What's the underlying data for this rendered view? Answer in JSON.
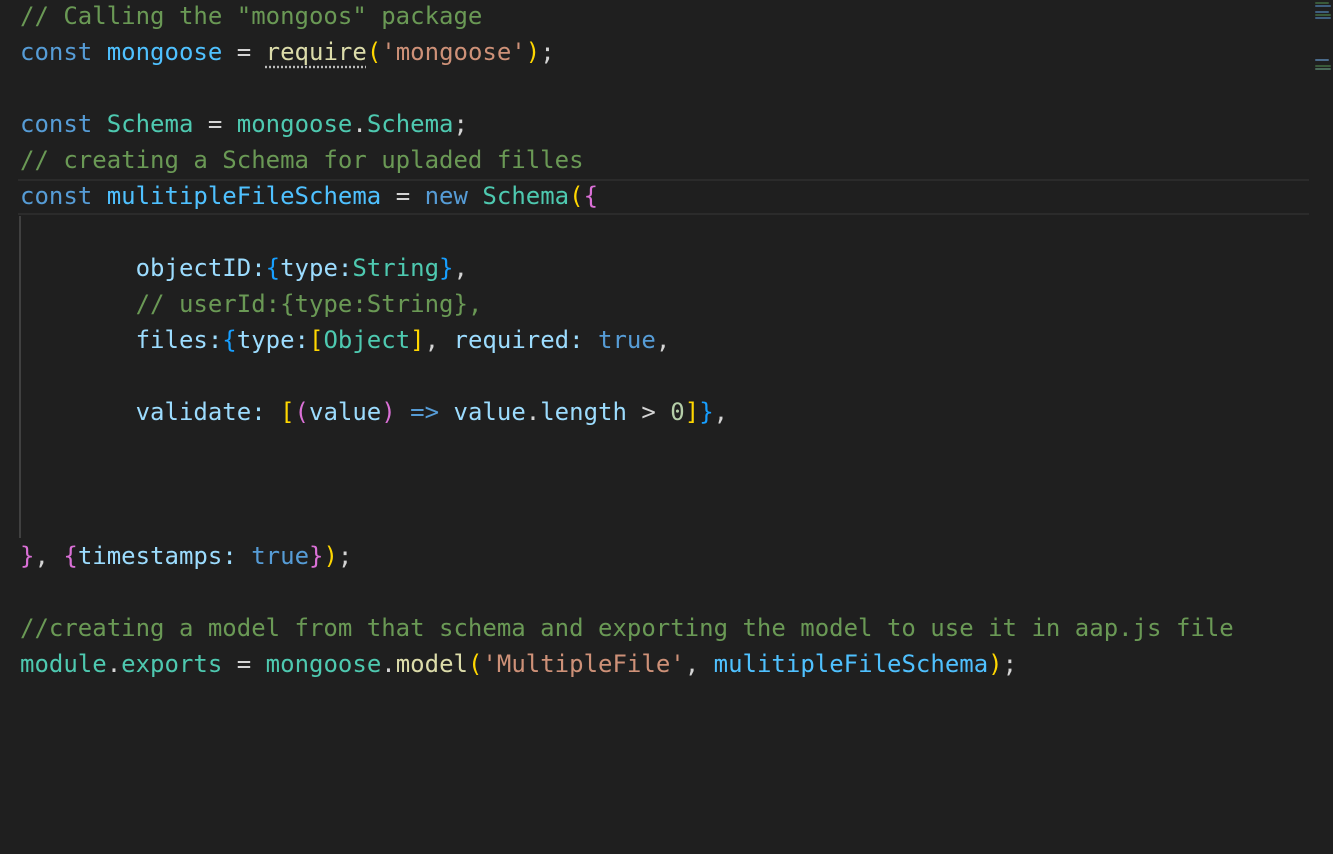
{
  "editor": {
    "language": "javascript",
    "lines": [
      {
        "tokens": [
          {
            "t": "// Calling the \"mongoos\" package",
            "c": "comment"
          }
        ]
      },
      {
        "tokens": [
          {
            "t": "const",
            "c": "kw"
          },
          {
            "t": " ",
            "c": "op"
          },
          {
            "t": "mongoose",
            "c": "const"
          },
          {
            "t": " = ",
            "c": "op"
          },
          {
            "t": "require",
            "c": "fn",
            "squiggle": true
          },
          {
            "t": "(",
            "c": "b1"
          },
          {
            "t": "'mongoose'",
            "c": "str"
          },
          {
            "t": ")",
            "c": "b1"
          },
          {
            "t": ";",
            "c": "op"
          }
        ]
      },
      {
        "tokens": []
      },
      {
        "tokens": [
          {
            "t": "const",
            "c": "kw"
          },
          {
            "t": " ",
            "c": "op"
          },
          {
            "t": "Schema",
            "c": "type"
          },
          {
            "t": " = ",
            "c": "op"
          },
          {
            "t": "mongoose",
            "c": "type"
          },
          {
            "t": ".",
            "c": "op"
          },
          {
            "t": "Schema",
            "c": "type"
          },
          {
            "t": ";",
            "c": "op"
          }
        ]
      },
      {
        "tokens": [
          {
            "t": "// creating a Schema for upladed filles",
            "c": "comment"
          }
        ]
      },
      {
        "current": true,
        "tokens": [
          {
            "t": "const",
            "c": "kw"
          },
          {
            "t": " ",
            "c": "op"
          },
          {
            "t": "mulitipleFileSchema",
            "c": "const"
          },
          {
            "t": " = ",
            "c": "op"
          },
          {
            "t": "new",
            "c": "kw"
          },
          {
            "t": " ",
            "c": "op"
          },
          {
            "t": "Schema",
            "c": "type"
          },
          {
            "t": "(",
            "c": "b1"
          },
          {
            "t": "{",
            "c": "b2"
          }
        ]
      },
      {
        "tokens": []
      },
      {
        "tokens": [
          {
            "t": "        ",
            "c": "op"
          },
          {
            "t": "objectID",
            "c": "var"
          },
          {
            "t": ":",
            "c": "var"
          },
          {
            "t": "{",
            "c": "b3"
          },
          {
            "t": "type",
            "c": "var"
          },
          {
            "t": ":",
            "c": "var"
          },
          {
            "t": "String",
            "c": "type"
          },
          {
            "t": "}",
            "c": "b3"
          },
          {
            "t": ",",
            "c": "op"
          }
        ]
      },
      {
        "tokens": [
          {
            "t": "        ",
            "c": "op"
          },
          {
            "t": "// userId:{type:String},",
            "c": "comment"
          }
        ]
      },
      {
        "tokens": [
          {
            "t": "        ",
            "c": "op"
          },
          {
            "t": "files",
            "c": "var"
          },
          {
            "t": ":",
            "c": "var"
          },
          {
            "t": "{",
            "c": "b3"
          },
          {
            "t": "type",
            "c": "var"
          },
          {
            "t": ":",
            "c": "var"
          },
          {
            "t": "[",
            "c": "b1"
          },
          {
            "t": "Object",
            "c": "type"
          },
          {
            "t": "]",
            "c": "b1"
          },
          {
            "t": ", ",
            "c": "op"
          },
          {
            "t": "required",
            "c": "var"
          },
          {
            "t": ": ",
            "c": "var"
          },
          {
            "t": "true",
            "c": "kw"
          },
          {
            "t": ",",
            "c": "op"
          }
        ]
      },
      {
        "tokens": []
      },
      {
        "tokens": [
          {
            "t": "        ",
            "c": "op"
          },
          {
            "t": "validate",
            "c": "var"
          },
          {
            "t": ": ",
            "c": "var"
          },
          {
            "t": "[",
            "c": "b1"
          },
          {
            "t": "(",
            "c": "b2"
          },
          {
            "t": "value",
            "c": "var"
          },
          {
            "t": ")",
            "c": "b2"
          },
          {
            "t": " ",
            "c": "op"
          },
          {
            "t": "=>",
            "c": "kw"
          },
          {
            "t": " ",
            "c": "op"
          },
          {
            "t": "value",
            "c": "var"
          },
          {
            "t": ".",
            "c": "op"
          },
          {
            "t": "length",
            "c": "var"
          },
          {
            "t": " > ",
            "c": "op"
          },
          {
            "t": "0",
            "c": "num"
          },
          {
            "t": "]",
            "c": "b1"
          },
          {
            "t": "}",
            "c": "b3"
          },
          {
            "t": ",",
            "c": "op"
          }
        ]
      },
      {
        "tokens": []
      },
      {
        "tokens": []
      },
      {
        "tokens": []
      },
      {
        "tokens": [
          {
            "t": "}",
            "c": "b2"
          },
          {
            "t": ", ",
            "c": "op"
          },
          {
            "t": "{",
            "c": "b2"
          },
          {
            "t": "timestamps",
            "c": "var"
          },
          {
            "t": ": ",
            "c": "var"
          },
          {
            "t": "true",
            "c": "kw"
          },
          {
            "t": "}",
            "c": "b2"
          },
          {
            "t": ")",
            "c": "b1"
          },
          {
            "t": ";",
            "c": "op"
          }
        ]
      },
      {
        "tokens": []
      },
      {
        "tokens": [
          {
            "t": "//creating a model from that schema and exporting the model to use it in aap.js file",
            "c": "comment"
          }
        ]
      },
      {
        "tokens": [
          {
            "t": "module",
            "c": "type"
          },
          {
            "t": ".",
            "c": "op"
          },
          {
            "t": "exports",
            "c": "type"
          },
          {
            "t": " = ",
            "c": "op"
          },
          {
            "t": "mongoose",
            "c": "type"
          },
          {
            "t": ".",
            "c": "op"
          },
          {
            "t": "model",
            "c": "fn"
          },
          {
            "t": "(",
            "c": "b1"
          },
          {
            "t": "'MultipleFile'",
            "c": "str"
          },
          {
            "t": ", ",
            "c": "op"
          },
          {
            "t": "mulitipleFileSchema",
            "c": "const"
          },
          {
            "t": ")",
            "c": "b1"
          },
          {
            "t": ";",
            "c": "op"
          }
        ]
      }
    ]
  },
  "colors": {
    "background": "#1f1f1f",
    "comment": "#6a9955",
    "keyword": "#569cd6",
    "variable": "#9cdcfe",
    "type": "#4ec9b0",
    "function": "#dcdcaa",
    "string": "#ce9178",
    "bracket_gold": "#ffd700",
    "bracket_orchid": "#da70d6",
    "bracket_blue": "#179fff"
  }
}
